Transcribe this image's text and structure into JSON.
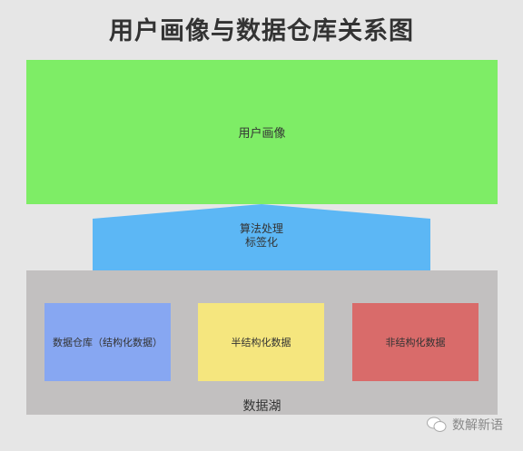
{
  "title": "用户画像与数据仓库关系图",
  "top_layer": {
    "label": "用户画像",
    "color": "#7eed66"
  },
  "middle_layer": {
    "line1": "算法处理",
    "line2": "标签化",
    "color": "#5cb7f5"
  },
  "data_lake": {
    "label": "数据湖",
    "color": "#c2c0c0",
    "boxes": [
      {
        "label": "数据仓库（结构化数据）",
        "color": "#87a7f2"
      },
      {
        "label": "半结构化数据",
        "color": "#f5e67e"
      },
      {
        "label": "非结构化数据",
        "color": "#d96b6a"
      }
    ]
  },
  "watermark": {
    "text": "数解新语",
    "icon": "wechat-icon"
  }
}
